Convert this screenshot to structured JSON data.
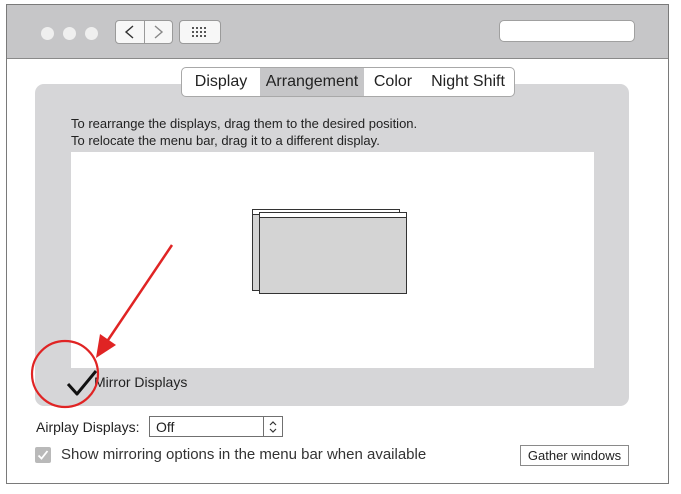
{
  "search": {
    "value": "",
    "placeholder": ""
  },
  "tabs": [
    {
      "label": "Display",
      "active": false
    },
    {
      "label": "Arrangement",
      "active": true
    },
    {
      "label": "Color",
      "active": false
    },
    {
      "label": "Night Shift",
      "active": false
    }
  ],
  "instructions": {
    "line1": "To rearrange the displays, drag them to the desired position.",
    "line2": "To relocate the menu bar, drag it to a different display."
  },
  "mirror": {
    "label": "Mirror Displays",
    "checked": true
  },
  "airplay": {
    "label": "Airplay Displays:",
    "selected": "Off"
  },
  "show_mirroring": {
    "label": "Show mirroring options in the menu bar when available",
    "checked": true
  },
  "gather_button": {
    "label": "Gather windows"
  },
  "icons": {
    "back": "chevron-left-icon",
    "forward": "chevron-right-icon",
    "show_all": "grid-icon",
    "stepper": "up-down-stepper-icon",
    "checkmark": "checkmark-icon"
  },
  "colors": {
    "titlebar": "#c6c6c8",
    "panel": "#d6d6d8",
    "active_tab": "#c6c6c8",
    "annotation": "#e02424"
  }
}
